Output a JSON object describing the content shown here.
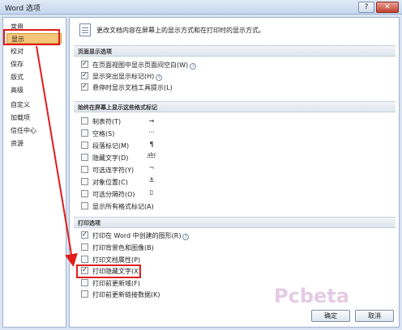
{
  "window": {
    "title": "Word 选项",
    "help": "?",
    "close": "✕"
  },
  "sidebar": {
    "items": [
      "常用",
      "显示",
      "校对",
      "保存",
      "版式",
      "高级",
      "自定义",
      "加载项",
      "信任中心",
      "资源"
    ],
    "active_index": 1
  },
  "main": {
    "description": "更改文档内容在屏幕上的显示方式和在打印时的显示方式。",
    "sections": {
      "page_display": {
        "title": "页面显示选项",
        "options": [
          {
            "label": "在页面视图中显示页面间空白(W)",
            "checked": true,
            "info": true
          },
          {
            "label": "显示突出显示标记(H)",
            "checked": true,
            "info": true
          },
          {
            "label": "悬停时显示文档工具提示(L)",
            "checked": true,
            "info": false
          }
        ]
      },
      "format_marks": {
        "title": "始终在屏幕上显示这些格式标记",
        "options": [
          {
            "label": "制表符(T)",
            "checked": false,
            "symbol": "→"
          },
          {
            "label": "空格(S)",
            "checked": false,
            "symbol": "···"
          },
          {
            "label": "段落标记(M)",
            "checked": false,
            "symbol": "¶"
          },
          {
            "label": "隐藏文字(D)",
            "checked": false,
            "symbol": "abc"
          },
          {
            "label": "可选连字符(Y)",
            "checked": false,
            "symbol": "¬"
          },
          {
            "label": "对象位置(C)",
            "checked": false,
            "symbol": "⚓"
          },
          {
            "label": "可选分隔符(O)",
            "checked": false,
            "symbol": "▯"
          },
          {
            "label": "显示所有格式标记(A)",
            "checked": false,
            "symbol": ""
          }
        ]
      },
      "print": {
        "title": "打印选项",
        "options": [
          {
            "label": "打印在 Word 中创建的图形(R)",
            "checked": true,
            "info": true
          },
          {
            "label": "打印背景色和图像(B)",
            "checked": false,
            "info": false
          },
          {
            "label": "打印文档属性(P)",
            "checked": false,
            "info": false
          },
          {
            "label": "打印隐藏文字(X)",
            "checked": true,
            "info": false
          },
          {
            "label": "打印前更新域(F)",
            "checked": false,
            "info": false
          },
          {
            "label": "打印前更新链接数据(K)",
            "checked": false,
            "info": false
          }
        ]
      }
    }
  },
  "buttons": {
    "ok": "确定",
    "cancel": "取消"
  },
  "watermark": "Pcbeta",
  "colors": {
    "highlight_red": "#e11c1c",
    "active_nav": "#f6c77a"
  }
}
